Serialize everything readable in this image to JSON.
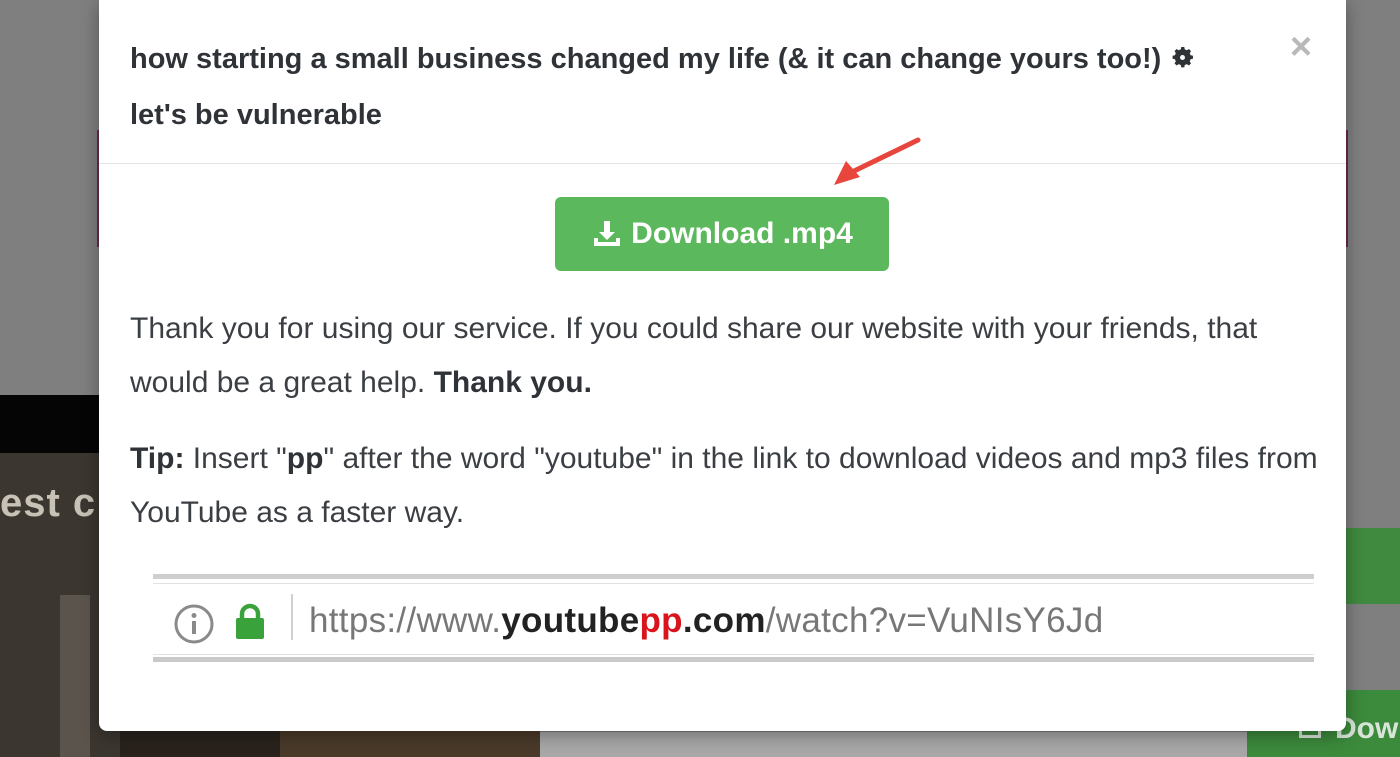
{
  "background": {
    "video_caption_fragment": "est c",
    "download_button_fragment": "Dow"
  },
  "modal": {
    "title_line1": "how starting a small business changed my life (& it can change yours too!)",
    "title_line2": "let's be vulnerable",
    "close_symbol": "×",
    "cog_icon": "cog-icon",
    "download_label": "Download .mp4",
    "download_icon": "download-icon",
    "download_color": "#5cb85c",
    "message_text": "Thank you for using our service. If you could share our website with your friends, that would be a great help.",
    "message_bold": "Thank you.",
    "tip": {
      "label": "Tip:",
      "part1": "Insert \"",
      "keyword": "pp",
      "part2": "\" after the word \"youtube\" in the link to download videos and mp3 files from YouTube as a faster way."
    },
    "url_example": {
      "prefix": "https://www.",
      "domain": "youtube",
      "insert": "pp",
      "tld": ".com",
      "path": "/watch?v=VuNIsY6Jd",
      "insert_color": "#d9141b",
      "lock_color": "#3aa23a"
    }
  }
}
